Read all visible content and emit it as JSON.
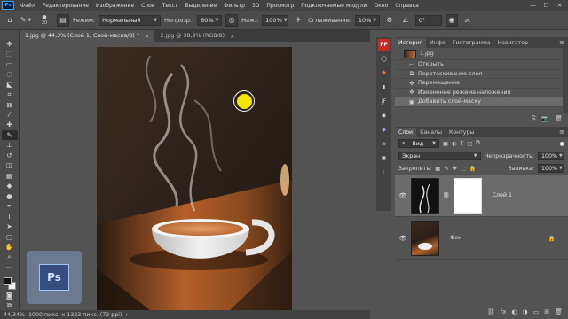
{
  "app": {
    "logo_text": "Ps",
    "menu": [
      "Файл",
      "Редактирование",
      "Изображение",
      "Слои",
      "Текст",
      "Выделение",
      "Фильтр",
      "3D",
      "Просмотр",
      "Подключаемые модули",
      "Окно",
      "Справка"
    ],
    "window_controls": [
      "—",
      "☐",
      "✕"
    ]
  },
  "options_bar": {
    "brush_size": "20",
    "mode_label": "Режим:",
    "mode_value": "Нормальный",
    "opacity_label": "Непрозр.:",
    "opacity_value": "60%",
    "pressure_label": "Наж.:",
    "pressure_value": "100%",
    "smoothing_label": "Сглаживание:",
    "smoothing_value": "10%",
    "angle_value": "0°"
  },
  "tabs": [
    {
      "label": "1.jpg @ 44,3% (Слой 1, Слой-маска/8) *",
      "close": "×",
      "active": true
    },
    {
      "label": "2.jpg @ 38,9% (RGB/8)",
      "close": "×",
      "active": false
    }
  ],
  "status_bar": {
    "zoom": "44,34%",
    "doc_info": "1000 пикс. x 1333 пикс. (72 ppi)",
    "arrow": "›"
  },
  "watermark_text": "Ps",
  "side_strip_icons": [
    "FP",
    "◯",
    "✱",
    "▮",
    "jF",
    "◉",
    "◆",
    "≋",
    "▣",
    "⫶"
  ],
  "history_panel": {
    "tabs": [
      "История",
      "Инфо",
      "Гистограмма",
      "Навигатор"
    ],
    "menu": "≡",
    "snapshot": "1.jpg",
    "steps": [
      {
        "icon": "▭",
        "label": "Открыть",
        "selected": false
      },
      {
        "icon": "⧉",
        "label": "Перетаскивание слоя",
        "selected": false
      },
      {
        "icon": "✥",
        "label": "Перемещение",
        "selected": false
      },
      {
        "icon": "✥",
        "label": "Изменение режима наложения",
        "selected": false
      },
      {
        "icon": "▣",
        "label": "Добавить слой-маску",
        "selected": true
      }
    ],
    "footer_icons": [
      "⎘",
      "📷",
      "🗑"
    ]
  },
  "layers_panel": {
    "tabs": [
      "Слои",
      "Каналы",
      "Контуры"
    ],
    "menu": "≡",
    "filter_label": "Вид",
    "blend_mode": "Экран",
    "opacity_label": "Непрозрачность:",
    "opacity_value": "100%",
    "lock_label": "Закрепить:",
    "fill_label": "Заливка:",
    "fill_value": "100%",
    "layers": [
      {
        "name": "Слой 1",
        "selected": true,
        "visible": true
      },
      {
        "name": "Фон",
        "selected": false,
        "visible": true,
        "locked": true
      }
    ],
    "footer_icons": [
      "⛓",
      "fx",
      "◐",
      "◑",
      "▭",
      "⊞",
      "🗑"
    ]
  },
  "colors": {
    "ui_dark": "#424242",
    "ui_mid": "#535353",
    "selection": "#6b6b6b",
    "brush_cursor": "#f5e600"
  }
}
